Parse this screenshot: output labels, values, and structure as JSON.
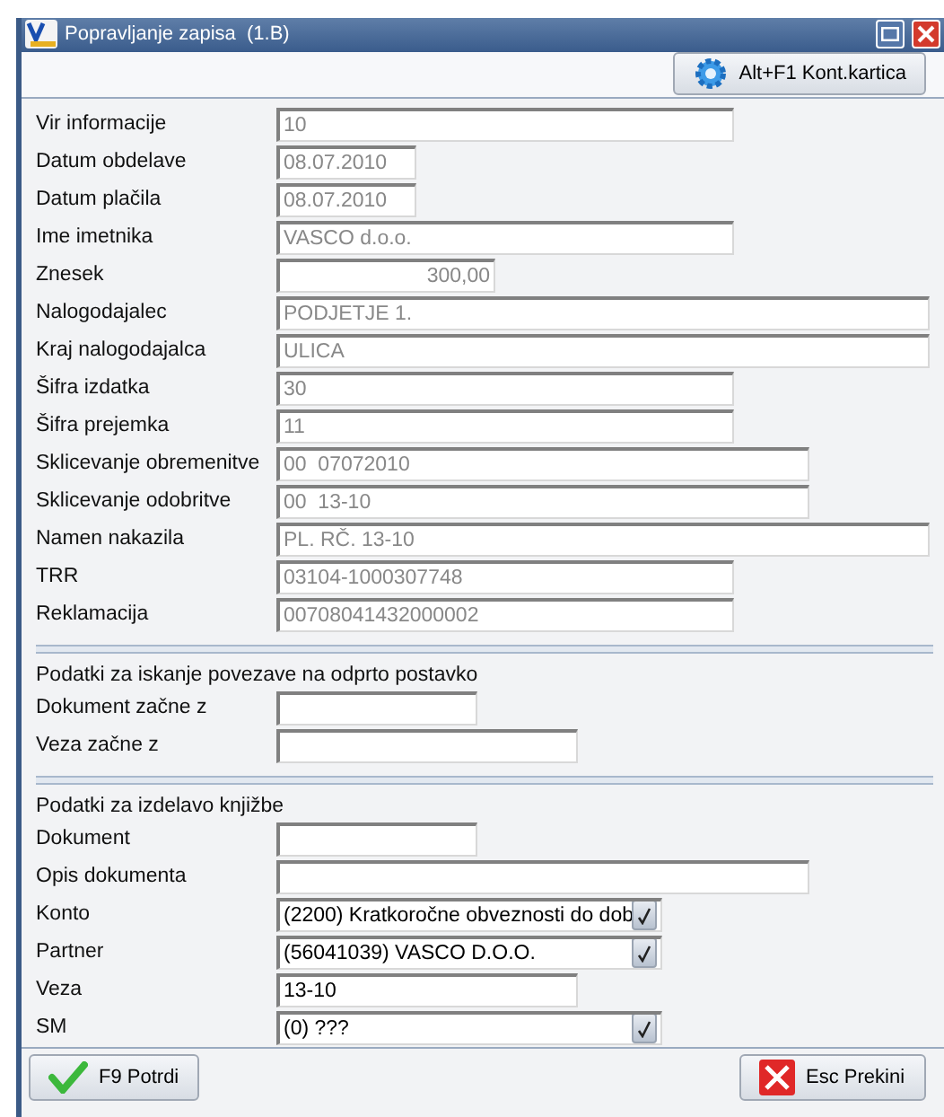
{
  "window": {
    "title": "Popravljanje zapisa  (1.B)"
  },
  "toolbar": {
    "button": "Alt+F1 Kont.kartica"
  },
  "sections": [
    {
      "fields": [
        {
          "label": "Vir informacije",
          "value": "10",
          "kind": "text",
          "readonly": true
        },
        {
          "label": "Datum obdelave",
          "value": "08.07.2010",
          "kind": "text",
          "readonly": true
        },
        {
          "label": "Datum plačila",
          "value": "08.07.2010",
          "kind": "text",
          "readonly": true
        },
        {
          "label": "Ime imetnika",
          "value": "VASCO d.o.o.",
          "kind": "text",
          "readonly": true
        },
        {
          "label": "Znesek",
          "value": "300,00",
          "kind": "amount",
          "readonly": true
        },
        {
          "label": "Nalogodajalec",
          "value": "PODJETJE 1.",
          "kind": "text",
          "readonly": true
        },
        {
          "label": "Kraj nalogodajalca",
          "value": "ULICA",
          "kind": "text",
          "readonly": true
        },
        {
          "label": "Šifra izdatka",
          "value": "30",
          "kind": "text",
          "readonly": true
        },
        {
          "label": "Šifra prejemka",
          "value": "11",
          "kind": "text",
          "readonly": true
        },
        {
          "label": "Sklicevanje obremenitve",
          "value": "00  07072010",
          "kind": "text",
          "readonly": true
        },
        {
          "label": "Sklicevanje odobritve",
          "value": "00  13-10",
          "kind": "text",
          "readonly": true
        },
        {
          "label": "Namen nakazila",
          "value": "PL. RČ. 13-10",
          "kind": "text",
          "readonly": true
        },
        {
          "label": "TRR",
          "value": "03104-1000307748",
          "kind": "text",
          "readonly": true
        },
        {
          "label": "Reklamacija",
          "value": "00708041432000002",
          "kind": "text",
          "readonly": true
        }
      ]
    },
    {
      "heading": "Podatki za iskanje povezave na odprto postavko",
      "fields": [
        {
          "label": "Dokument začne z",
          "kind": "text"
        },
        {
          "label": "Veza začne z",
          "kind": "text"
        }
      ]
    },
    {
      "heading": "Podatki za izdelavo knjižbe",
      "fields": [
        {
          "label": "Dokument",
          "kind": "text"
        },
        {
          "label": "Opis dokumenta",
          "kind": "text"
        },
        {
          "label": "Konto",
          "value": "(2200) Kratkoročne obveznosti do dob",
          "kind": "combo",
          "readonly": false
        },
        {
          "label": "Partner",
          "value": "(56041039) VASCO D.O.O.",
          "kind": "combo",
          "readonly": false
        },
        {
          "label": "Veza",
          "value": "13-10",
          "kind": "text",
          "readonly": false
        },
        {
          "label": "SM",
          "value": "(0) ???",
          "kind": "combo",
          "readonly": false
        }
      ]
    }
  ],
  "footer": {
    "confirm": "F9 Potrdi",
    "cancel": "Esc Prekini"
  }
}
